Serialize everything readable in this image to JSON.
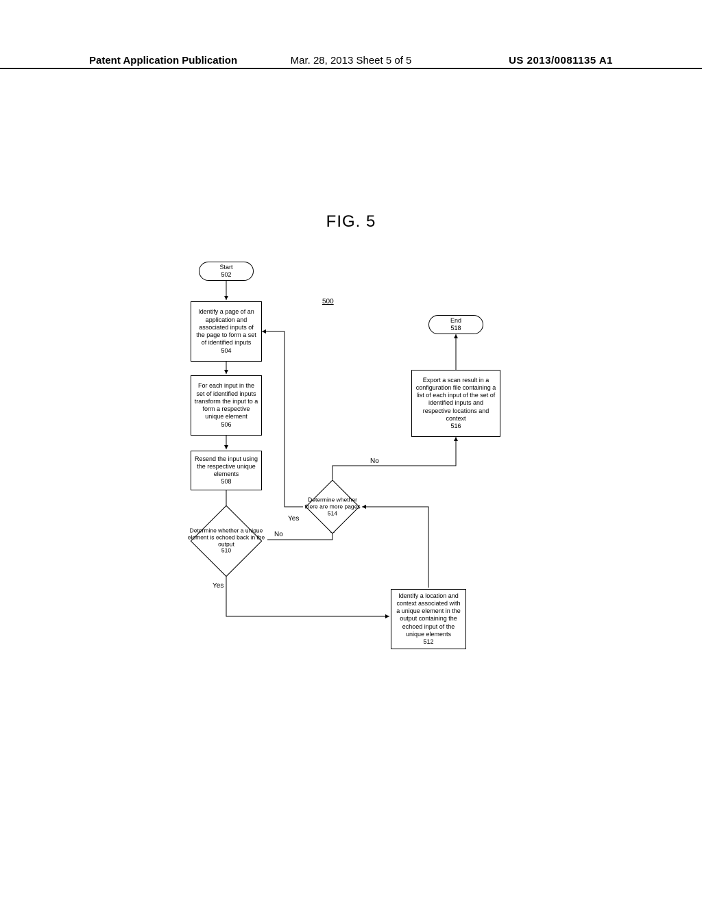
{
  "header": {
    "left": "Patent Application Publication",
    "mid": "Mar. 28, 2013  Sheet 5 of 5",
    "right": "US 2013/0081135 A1"
  },
  "figure": {
    "title": "FIG. 5",
    "ref": "500"
  },
  "nodes": {
    "start": {
      "label": "Start",
      "num": "502"
    },
    "end": {
      "label": "End",
      "num": "518"
    },
    "n504": {
      "text": "Identify a page of an application and associated inputs of the page to form a set of identified inputs",
      "num": "504"
    },
    "n506": {
      "text": "For each input in the set of identified inputs transform the input to a form a respective unique element",
      "num": "506"
    },
    "n508": {
      "text": "Resend the input using the respective unique elements",
      "num": "508"
    },
    "n510": {
      "text": "Determine whether a unique element is echoed back in the output",
      "num": "510"
    },
    "n512": {
      "text": "Identify a location and context associated with a unique element in the output containing the echoed input of the unique elements",
      "num": "512"
    },
    "n514": {
      "text": "Determine whether there are more pages",
      "num": "514"
    },
    "n516": {
      "text": "Export a scan result in a configuration file containing a list of each input of the set of identified inputs and respective locations and context",
      "num": "516"
    }
  },
  "labels": {
    "yes": "Yes",
    "no": "No"
  }
}
